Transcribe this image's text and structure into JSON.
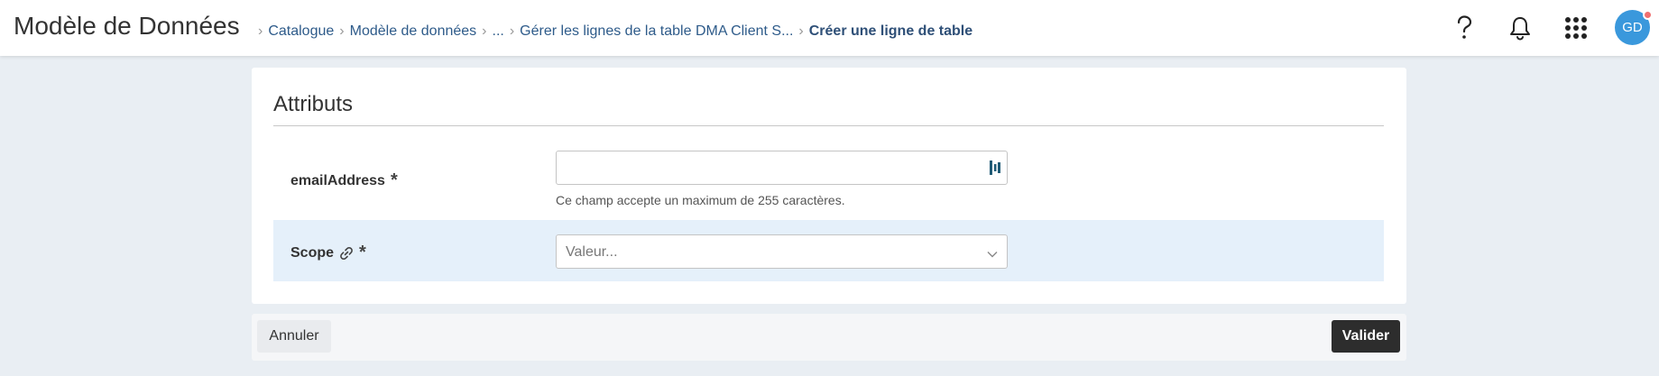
{
  "header": {
    "app_title": "Modèle de Données",
    "breadcrumb": [
      {
        "label": "Catalogue"
      },
      {
        "label": "Modèle de données"
      },
      {
        "label": "..."
      },
      {
        "label": "Gérer les lignes de la table DMA Client S..."
      },
      {
        "label": "Créer une ligne de table"
      }
    ],
    "icons": [
      "help-icon",
      "bell-icon",
      "apps-grid-icon"
    ],
    "avatar_initials": "GD",
    "avatar_color": "#3a98dc",
    "notification_dot_color": "#f07070"
  },
  "form": {
    "section_title": "Attributs",
    "fields": [
      {
        "label": "emailAddress",
        "required_mark": "*",
        "value": "",
        "helper": "Ce champ accepte un maximum de 255 caractères."
      },
      {
        "label": "Scope",
        "required_mark": "*",
        "placeholder": "Valeur...",
        "highlight_color": "#e5f0fa"
      }
    ]
  },
  "footer": {
    "cancel_label": "Annuler",
    "validate_label": "Valider"
  }
}
